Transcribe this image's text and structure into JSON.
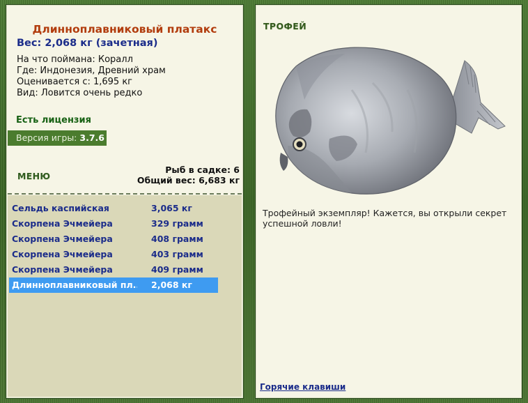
{
  "fish": {
    "title": "Длинноплавниковый платакс",
    "weight_label": "Вес:",
    "weight_value": "2,068 кг (зачетная)",
    "bait": "На что поймана: Коралл",
    "where": "Где: Индонезия, Древний храм",
    "price": "Оценивается с: 1,695 кг",
    "kind": "Вид: Ловится очень редко"
  },
  "license": "Есть лицензия",
  "version": {
    "label": "Версия игры:",
    "value": "3.7.6"
  },
  "menu_label": "МЕНЮ",
  "keep": {
    "count": "Рыб в садке: 6",
    "total": "Общий вес: 6,683 кг"
  },
  "catches": [
    {
      "name": "Сельдь каспийская",
      "weight": "3,065 кг"
    },
    {
      "name": "Скорпена Эчмейера",
      "weight": "329 грамм"
    },
    {
      "name": "Скорпена Эчмейера",
      "weight": "408 грамм"
    },
    {
      "name": "Скорпена Эчмейера",
      "weight": "403 грамм"
    },
    {
      "name": "Скорпена Эчмейера",
      "weight": "409 грамм"
    },
    {
      "name": "Длинноплавниковый пл...",
      "weight": "2,068 кг",
      "selected": true
    }
  ],
  "trophy": {
    "label": "ТРОФЕЙ",
    "text": "Трофейный экземпляр! Кажется, вы открыли секрет успешной ловли!"
  },
  "hotkeys": "Горячие клавиши",
  "colors": {
    "frame": "#3f6b2a",
    "panel": "#f6f5e6",
    "title": "#b23d0e",
    "link": "#1b2c8a",
    "selected": "#3e9bf1",
    "license": "#176114"
  },
  "icons": {
    "fish_image": "platax-fish-image"
  }
}
